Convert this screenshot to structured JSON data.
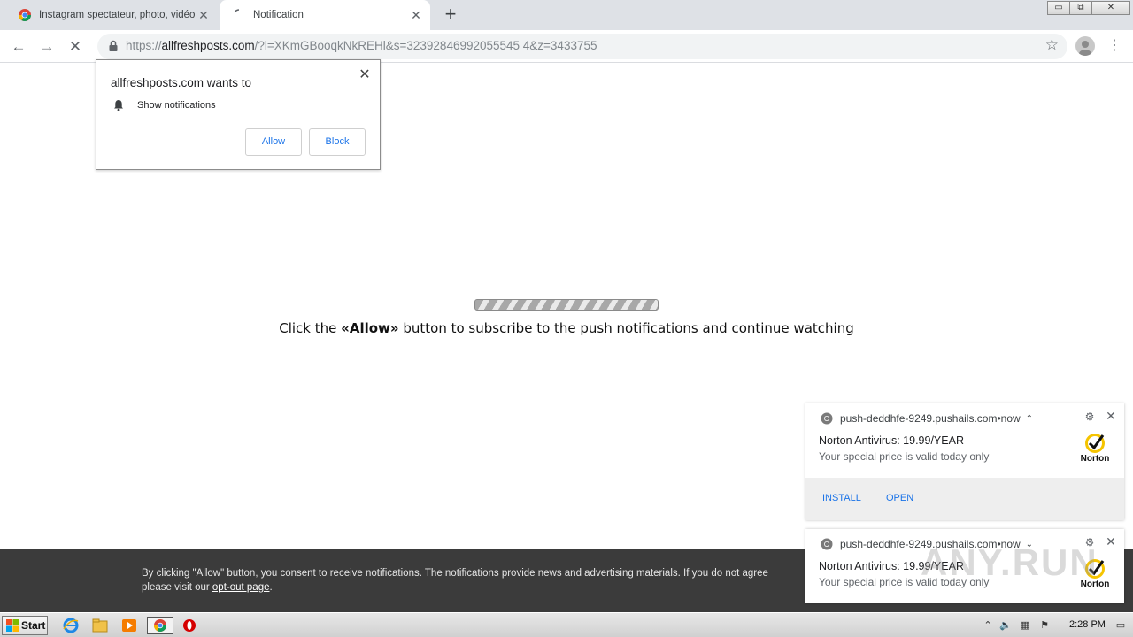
{
  "tabs": [
    {
      "title": "Instagram spectateur, photo, vidéo",
      "active": false,
      "favicon": "chrome-colored-icon"
    },
    {
      "title": "Notification",
      "active": true,
      "favicon": "loading-spinner-icon"
    }
  ],
  "window_controls": {
    "minimize": "▭",
    "restore": "⧉",
    "close": "✕"
  },
  "toolbar": {
    "url_scheme": "https://",
    "url_host": "allfreshposts.com",
    "url_path": "/?l=XKmGBooqkNkREHl&s=32392846992055545 4&z=3433755"
  },
  "permission_popup": {
    "title": "allfreshposts.com wants to",
    "permission": "Show notifications",
    "allow": "Allow",
    "block": "Block"
  },
  "page": {
    "message_before": "Click the ",
    "message_bold": "«Allow»",
    "message_after": " button to subscribe to the push notifications and continue watching"
  },
  "consent": {
    "line1": "By clicking \"Allow\" button, you consent to receive notifications. The notifications provide news and advertising materials. If you do not agree",
    "line2_before": "please visit our ",
    "link": "opt-out page",
    "line2_after": "."
  },
  "notifications": [
    {
      "source": "push-deddhfe-9249.pushails.com",
      "sep": " • ",
      "time": "now",
      "chevron": "⌃",
      "title": "Norton Antivirus: 19.99/YEAR",
      "body": "Your special price is valid today only",
      "logo_text": "Norton",
      "actions": [
        "INSTALL",
        "OPEN"
      ]
    },
    {
      "source": "push-deddhfe-9249.pushails.com",
      "sep": " • ",
      "time": "now",
      "chevron": "⌄",
      "title": "Norton Antivirus: 19.99/YEAR",
      "body": "Your special price is valid today only",
      "logo_text": "Norton"
    }
  ],
  "watermark": "ANY.RUN",
  "taskbar": {
    "start": "Start",
    "clock": "2:28 PM"
  },
  "colors": {
    "tabstrip": "#dee1e6",
    "link_blue": "#1a73e8",
    "consent_bg": "#3b3b3b",
    "norton_yellow": "#f5c400"
  }
}
